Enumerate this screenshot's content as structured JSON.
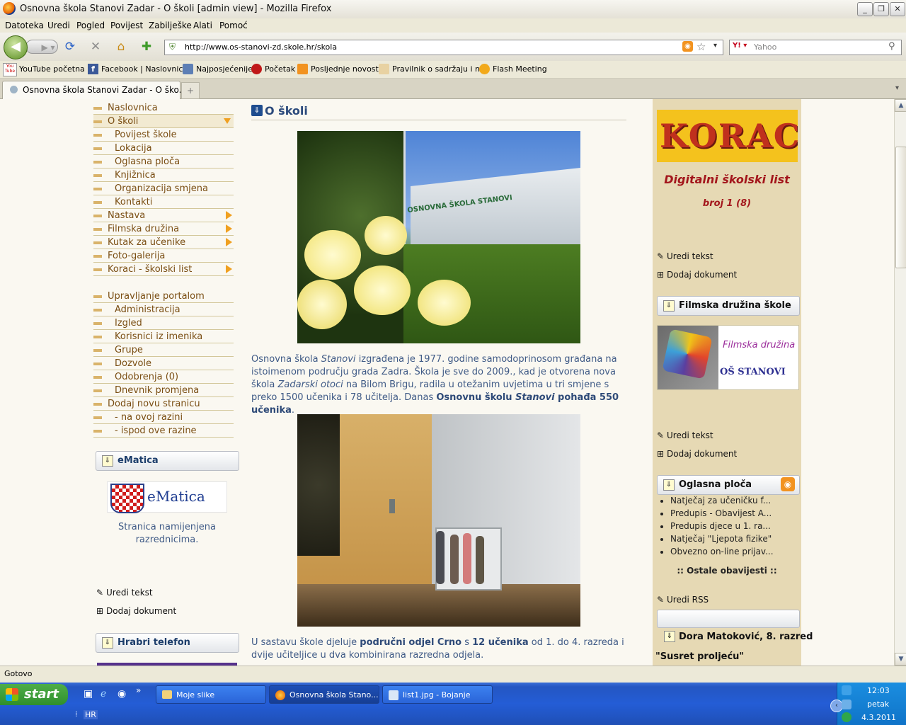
{
  "window": {
    "title": "Osnovna škola Stanovi Zadar - O školi [admin view] - Mozilla Firefox"
  },
  "menu": [
    "Datoteka",
    "Uredi",
    "Pogled",
    "Povijest",
    "Zabilješke",
    "Alati",
    "Pomoć"
  ],
  "toolbar": {
    "url": "http://www.os-stanovi-zd.skole.hr/skola",
    "search_placeholder": "Yahoo"
  },
  "bookmarks": [
    "YouTube početna",
    "Facebook | Naslovnica",
    "Najposjećenije",
    "Početak",
    "Posljednje novosti",
    "Pravilnik o sadržaju i n...",
    "Flash Meeting"
  ],
  "bookmark_youtube_logo": "You Tube",
  "tab": {
    "label": "Osnovna škola Stanovi Zadar - O ško...",
    "new_tab": "+"
  },
  "left_nav": [
    {
      "label": "Naslovnica",
      "indent": false,
      "arrow": false
    },
    {
      "label": "O školi",
      "indent": false,
      "arrow": "down"
    },
    {
      "label": "Povijest škole",
      "indent": true,
      "arrow": false
    },
    {
      "label": "Lokacija",
      "indent": true,
      "arrow": false
    },
    {
      "label": "Oglasna ploča",
      "indent": true,
      "arrow": false
    },
    {
      "label": "Knjižnica",
      "indent": true,
      "arrow": false
    },
    {
      "label": "Organizacija smjena",
      "indent": true,
      "arrow": false
    },
    {
      "label": "Kontakti",
      "indent": true,
      "arrow": false
    },
    {
      "label": "Nastava",
      "indent": false,
      "arrow": "right"
    },
    {
      "label": "Filmska družina",
      "indent": false,
      "arrow": "right"
    },
    {
      "label": "Kutak za učenike",
      "indent": false,
      "arrow": "right"
    },
    {
      "label": "Foto-galerija",
      "indent": false,
      "arrow": false
    },
    {
      "label": "Koraci - školski list",
      "indent": false,
      "arrow": "right"
    }
  ],
  "admin_nav": [
    {
      "label": "Upravljanje portalom",
      "indent": false
    },
    {
      "label": "Administracija",
      "indent": true
    },
    {
      "label": "Izgled",
      "indent": true
    },
    {
      "label": "Korisnici iz imenika",
      "indent": true
    },
    {
      "label": "Grupe",
      "indent": true
    },
    {
      "label": "Dozvole",
      "indent": true
    },
    {
      "label": "Odobrenja (0)",
      "indent": true
    },
    {
      "label": "Dnevnik promjena",
      "indent": true
    },
    {
      "label": "Dodaj novu stranicu",
      "indent": false
    },
    {
      "label": "- na ovoj razini",
      "indent": true
    },
    {
      "label": "- ispod ove razine",
      "indent": true
    }
  ],
  "ematica": {
    "title": "eMatica",
    "logo_text": "eMatica",
    "description": "Stranica namijenjena razrednicima.",
    "edit_text": "Uredi tekst",
    "add_doc": "Dodaj dokument"
  },
  "hrabri": {
    "title": "Hrabri telefon"
  },
  "main": {
    "heading": "O školi",
    "photo1_sign": "OSNOVNA ŠKOLA STANOVI",
    "p1_parts": [
      "Osnovna škola ",
      "Stanovi",
      " izgrađena je 1977. godine samodoprinosom građana na istoimenom području grada Zadra. Škola je sve do 2009., kad je otvorena nova škola ",
      "Zadarski otoci",
      " na Bilom Brigu, radila u otežanim uvjetima u tri smjene s preko 1500 učenika i 78 učitelja.  Danas ",
      "Osnovnu školu ",
      "Stanovi",
      " pohađa 550 učenika",
      "."
    ],
    "p2_parts": [
      "U sastavu škole djeluje ",
      "područni odjel Crno",
      " s ",
      "12 učenika",
      " od 1. do 4. razreda i dvije učiteljice u dva kombinirana razredna odjela."
    ]
  },
  "right": {
    "koraci_logo": "KORACI",
    "koraci_sub": "Digitalni školski list",
    "koraci_issue": "broj 1 (8)",
    "edit_text": "Uredi tekst",
    "add_doc": "Dodaj dokument",
    "film_title": "Filmska družina škole",
    "film_logo_line1": "Filmska družina",
    "film_logo_line2": "OŠ STANOVI",
    "board_title": "Oglasna ploča",
    "board_items": [
      "Natječaj za učeničku f...",
      "Predupis - Obavijest A...",
      "Predupis djece u 1. ra...",
      "Natječaj \"Ljepota fizike\"",
      "Obvezno on-line prijav..."
    ],
    "board_more": ":: Ostale obavijesti ::",
    "rss_edit": "Uredi RSS",
    "dora": "Dora Matoković, 8. razred",
    "usust": "\"Susret proljeću\""
  },
  "status": "Gotovo",
  "taskbar": {
    "start": "start",
    "tasks": [
      "Moje slike",
      "Osnovna škola Stano...",
      "list1.jpg - Bojanje"
    ],
    "lang": "HR",
    "time": "12:03",
    "day": "petak",
    "date": "4.3.2011"
  }
}
